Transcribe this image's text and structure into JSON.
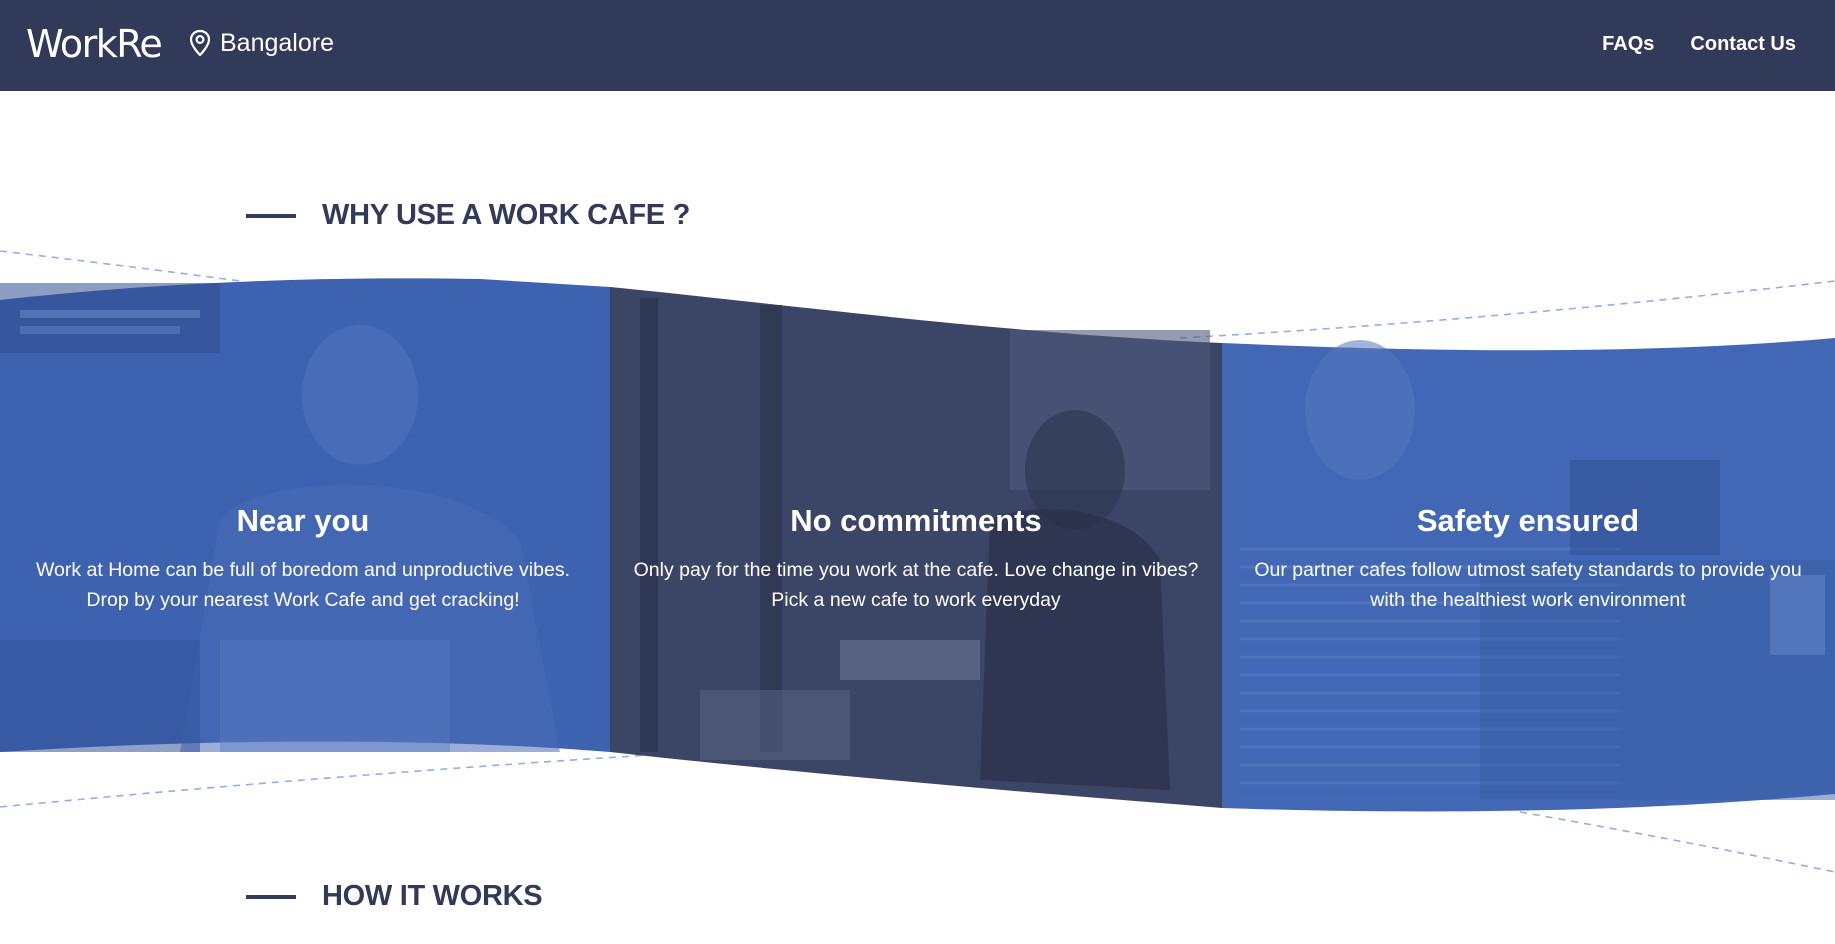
{
  "header": {
    "logo": "WorkRe",
    "location_icon": "map-pin-icon",
    "location": "Bangalore",
    "nav": [
      {
        "label": "FAQs"
      },
      {
        "label": "Contact Us"
      }
    ]
  },
  "why_section": {
    "title": "WHY USE A WORK CAFE ?",
    "cards": [
      {
        "title": "Near you",
        "description": "Work at Home can be full of boredom and unproductive vibes. Drop by your nearest Work Cafe and get cracking!"
      },
      {
        "title": "No commitments",
        "description": "Only pay for the time you work at the cafe. Love change in vibes? Pick a new cafe to work everyday"
      },
      {
        "title": "Safety ensured",
        "description": "Our partner cafes follow utmost safety standards to provide you with the healthiest work environment"
      }
    ]
  },
  "how_section": {
    "title": "HOW IT WORKS"
  },
  "colors": {
    "header_bg": "#313a58",
    "heading_text": "#313a58",
    "card_blue": "#3d62b0",
    "card_dark": "#3b4566",
    "dashed_line": "#8fb0e3"
  }
}
